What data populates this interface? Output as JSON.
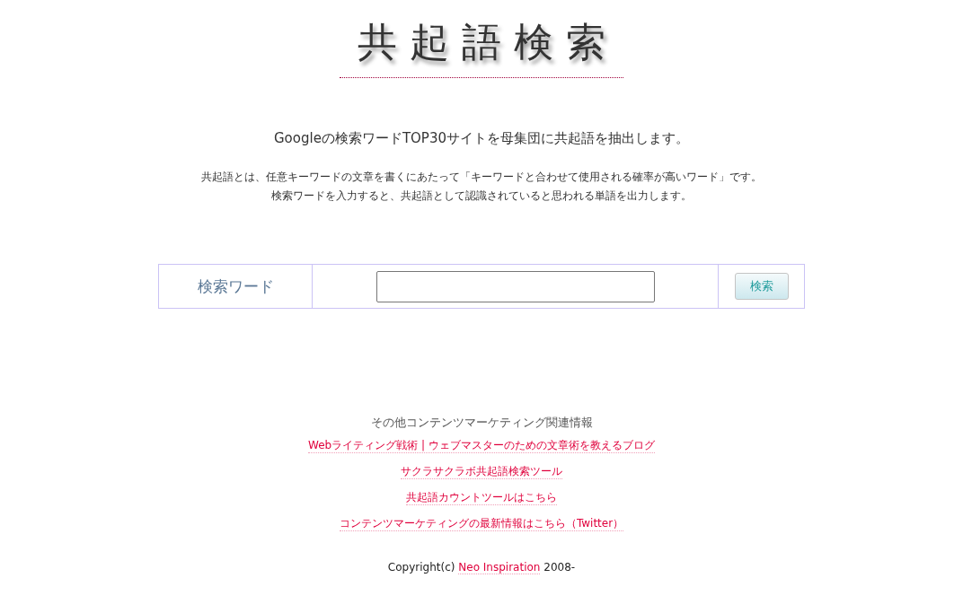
{
  "logo": "共起語検索",
  "headline": "Googleの検索ワードTOP30サイトを母集団に共起語を抽出します。",
  "description": [
    "共起語とは、任意キーワードの文章を書くにあたって「キーワードと合わせて使用される確率が高いワード」です。",
    "検索ワードを入力すると、共起語として認識されていると思われる単語を出力します。"
  ],
  "search_form": {
    "label": "検索ワード",
    "button": "検索"
  },
  "footer": {
    "heading": "その他コンテンツマーケティング関連情報",
    "links": [
      "Webライティング戦術 | ウェブマスターのための文章術を教えるブログ",
      "サクラサクラボ共起語検索ツール",
      "共起語カウントツールはこちら",
      "コンテンツマーケティングの最新情報はこちら（Twitter）"
    ],
    "copyright": {
      "prefix": "Copyright(c)",
      "link": "Neo Inspiration",
      "suffix": "2008-"
    }
  }
}
